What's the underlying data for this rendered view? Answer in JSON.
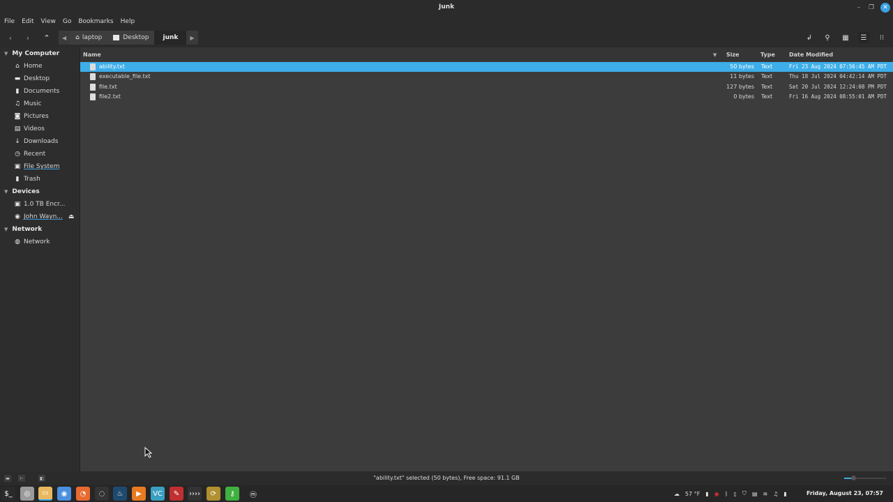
{
  "window": {
    "title": "Junk"
  },
  "menu": [
    "File",
    "Edit",
    "View",
    "Go",
    "Bookmarks",
    "Help"
  ],
  "breadcrumbs": [
    {
      "label": "laptop",
      "icon": "home-icon"
    },
    {
      "label": "Desktop",
      "icon": "desktop-icon"
    },
    {
      "label": "junk",
      "icon": "",
      "active": true
    }
  ],
  "sidebar": {
    "sections": [
      {
        "label": "My Computer",
        "items": [
          {
            "label": "Home",
            "icon": "home-icon",
            "glyph": "⌂"
          },
          {
            "label": "Desktop",
            "icon": "desktop-icon",
            "glyph": "▬"
          },
          {
            "label": "Documents",
            "icon": "document-icon",
            "glyph": "▮"
          },
          {
            "label": "Music",
            "icon": "music-icon",
            "glyph": "♫"
          },
          {
            "label": "Pictures",
            "icon": "camera-icon",
            "glyph": "◙"
          },
          {
            "label": "Videos",
            "icon": "film-icon",
            "glyph": "▤"
          },
          {
            "label": "Downloads",
            "icon": "download-icon",
            "glyph": "↓"
          },
          {
            "label": "Recent",
            "icon": "clock-icon",
            "glyph": "◷"
          },
          {
            "label": "File System",
            "icon": "drive-icon",
            "glyph": "▣",
            "underline": true
          },
          {
            "label": "Trash",
            "icon": "trash-icon",
            "glyph": "▮"
          }
        ]
      },
      {
        "label": "Devices",
        "items": [
          {
            "label": "1.0 TB Encr...",
            "icon": "drive-icon",
            "glyph": "▣"
          },
          {
            "label": "John Wayn...",
            "icon": "disc-icon",
            "glyph": "◉",
            "underline": true,
            "eject": true
          }
        ]
      },
      {
        "label": "Network",
        "items": [
          {
            "label": "Network",
            "icon": "globe-icon",
            "glyph": "◍"
          }
        ]
      }
    ]
  },
  "columns": {
    "name": "Name",
    "size": "Size",
    "type": "Type",
    "modified": "Date Modified"
  },
  "files": [
    {
      "name": "ability.txt",
      "size": "50 bytes",
      "type": "Text",
      "modified": "Fri 23 Aug 2024 07:56:45 AM PDT",
      "selected": true
    },
    {
      "name": "executable_file.txt",
      "size": "11 bytes",
      "type": "Text",
      "modified": "Thu 18 Jul 2024 04:42:14 AM PDT"
    },
    {
      "name": "file.txt",
      "size": "127 bytes",
      "type": "Text",
      "modified": "Sat 20 Jul 2024 12:24:08 PM PDT"
    },
    {
      "name": "file2.txt",
      "size": "0 bytes",
      "type": "Text",
      "modified": "Fri 16 Aug 2024 08:55:01 AM PDT"
    }
  ],
  "status": {
    "text": "\"ability.txt\" selected (50 bytes), Free space: 91.1 GB",
    "zoom_fraction": 0.2
  },
  "taskbar": {
    "apps": [
      {
        "name": "terminal",
        "glyph": "$_",
        "color": "#2a2a2a"
      },
      {
        "name": "disks",
        "glyph": "◎",
        "color": "#9a9a9a"
      },
      {
        "name": "files",
        "glyph": "▭",
        "color": "#e8b860"
      },
      {
        "name": "chrome",
        "glyph": "◉",
        "color": "#4a8fe0"
      },
      {
        "name": "firefox",
        "glyph": "◔",
        "color": "#e86a30"
      },
      {
        "name": "obs",
        "glyph": "◌",
        "color": "#333333"
      },
      {
        "name": "steam",
        "glyph": "♨",
        "color": "#1e4a70"
      },
      {
        "name": "vlc",
        "glyph": "▶",
        "color": "#e87a20"
      },
      {
        "name": "vscode",
        "glyph": "VC",
        "color": "#3aa0c0"
      },
      {
        "name": "gimp",
        "glyph": "✎",
        "color": "#c03030"
      },
      {
        "name": "video-editor",
        "glyph": "››››",
        "color": "#333333"
      },
      {
        "name": "update-manager",
        "glyph": "⟳",
        "color": "#b09030"
      },
      {
        "name": "key-manager",
        "glyph": "⚷",
        "color": "#40b040"
      },
      {
        "name": "mint-menu",
        "glyph": "ⓜ",
        "color": "#262626"
      }
    ],
    "tray": {
      "weather": "57 °F",
      "clock": "Friday, August 23, 07:57"
    }
  }
}
